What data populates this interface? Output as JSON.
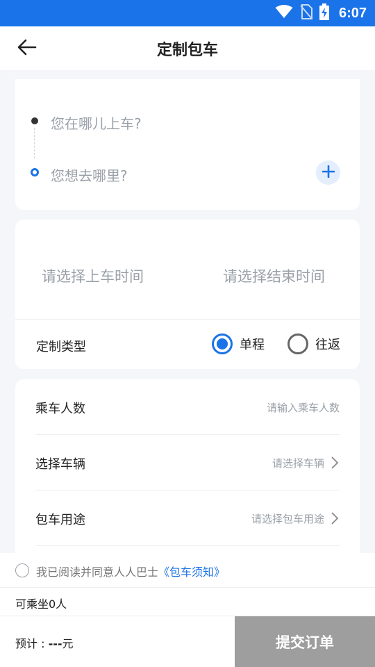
{
  "status_bar": {
    "time": "6:07",
    "icons": [
      "wifi-icon",
      "no-sim-icon",
      "battery-charging-icon"
    ]
  },
  "header": {
    "title": "定制包车",
    "back_icon": "arrow-left-icon"
  },
  "route": {
    "from_placeholder": "您在哪儿上车?",
    "to_placeholder": "您想去哪里?",
    "add_icon": "plus-icon"
  },
  "time": {
    "start_placeholder": "请选择上车时间",
    "end_placeholder": "请选择结束时间"
  },
  "trip_type": {
    "label": "定制类型",
    "options": [
      {
        "label": "单程",
        "selected": true
      },
      {
        "label": "往返",
        "selected": false
      }
    ]
  },
  "info": {
    "rows": [
      {
        "label": "乘车人数",
        "placeholder": "请输入乘车人数"
      },
      {
        "label": "选择车辆",
        "placeholder": "请选择车辆"
      },
      {
        "label": "包车用途",
        "placeholder": "请选择包车用途"
      }
    ]
  },
  "agreement": {
    "text": "我已阅读并同意人人巴士",
    "link": "《包车须知》"
  },
  "capacity": {
    "text": "可乘坐0人"
  },
  "footer": {
    "price_label": "预计 : ",
    "price_value": "---",
    "price_unit": "元",
    "submit_label": "提交订单"
  },
  "colors": {
    "primary": "#1a73e8",
    "status_bar": "#1a73e8",
    "submit_disabled": "#9e9e9e",
    "background": "#f4f6f9"
  }
}
